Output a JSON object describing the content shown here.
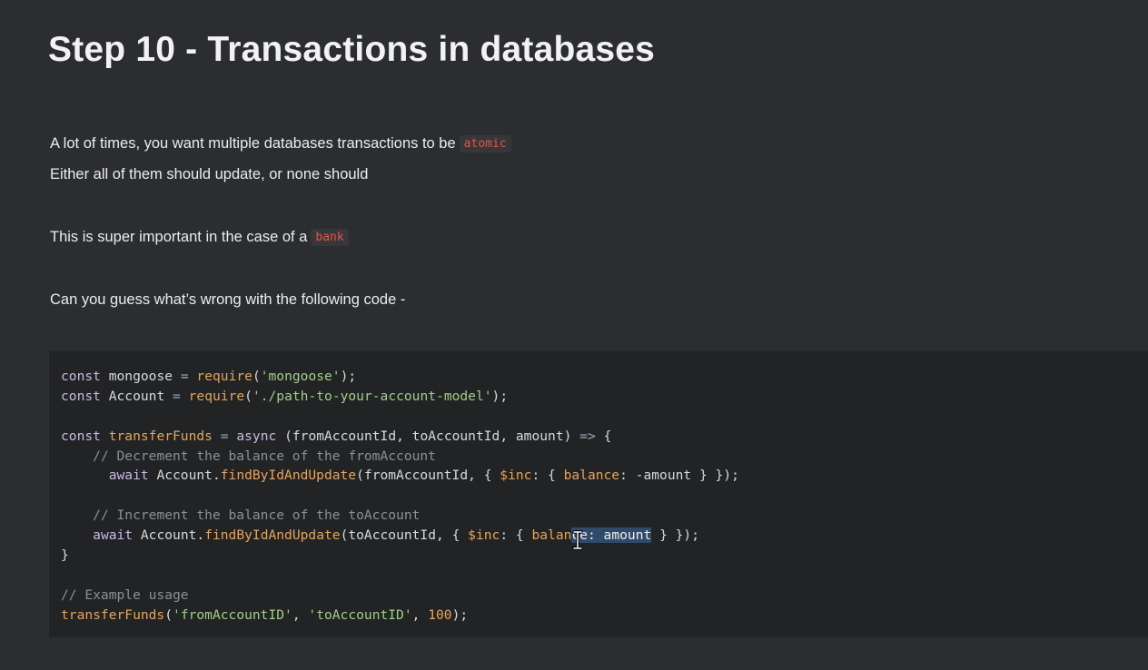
{
  "title": "Step 10 - Transactions in databases",
  "paragraphs": {
    "p1_text": "A lot of times, you want multiple databases transactions to be",
    "p1_code": "atomic",
    "p2_text": "Either all of them should update, or none should",
    "p3_text": "This is super important in the case of a",
    "p3_code": "bank",
    "p4_text": "Can you guess what’s wrong with the following code -"
  },
  "code": {
    "l1": {
      "kw": "const",
      "name": "mongoose",
      "eq": "=",
      "fn": "require",
      "open": "(",
      "str": "'mongoose'",
      "close": ");"
    },
    "l2": {
      "kw": "const",
      "name": "Account",
      "eq": "=",
      "fn": "require",
      "open": "(",
      "str": "'./path-to-your-account-model'",
      "close": ");"
    },
    "l3": {
      "kw": "const",
      "fn": "transferFunds",
      "eq": "=",
      "async": "async",
      "params": "(fromAccountId, toAccountId, amount)",
      "arrow": "=>",
      "brace": "{"
    },
    "l4": {
      "comment": "// Decrement the balance of the fromAccount"
    },
    "l5": {
      "await": "await",
      "obj": "Account.",
      "fn": "findByIdAndUpdate",
      "args": "(fromAccountId, { ",
      "inc": "$inc",
      "rest": ": { ",
      "prop": "balance",
      "tail": ": -amount } });"
    },
    "l6": {
      "comment": "// Increment the balance of the toAccount"
    },
    "l7": {
      "await": "await",
      "obj": "Account.",
      "fn": "findByIdAndUpdate",
      "args": "(toAccountId, { ",
      "inc": "$inc",
      "rest": ": { ",
      "prop": "balan",
      "sel": "ce: amount",
      "tail": " } });"
    },
    "l8": {
      "brace": "}"
    },
    "l9": {
      "comment": "// Example usage"
    },
    "l10": {
      "fn": "transferFunds",
      "open": "(",
      "s1": "'fromAccountID'",
      "comma1": ", ",
      "s2": "'toAccountID'",
      "comma2": ", ",
      "num": "100",
      "close": ");"
    }
  },
  "icons": {
    "cursor": "text-cursor-icon"
  }
}
